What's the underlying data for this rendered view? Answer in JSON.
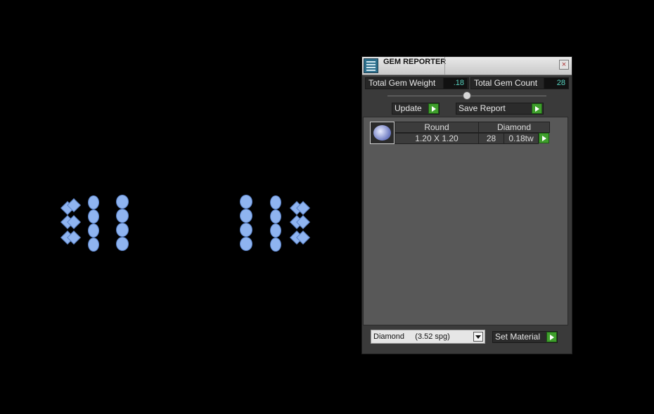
{
  "panel": {
    "title": "GEM REPORTER",
    "close": "×",
    "total_weight_label": "Total Gem Weight",
    "total_weight_value": ".18",
    "total_count_label": "Total Gem Count",
    "total_count_value": "28",
    "update_label": "Update",
    "save_report_label": "Save Report",
    "material_select_value": "Diamond     (3.52 spg)",
    "set_material_label": "Set Material",
    "rows": [
      {
        "shape": "Round",
        "material": "Diamond",
        "size": "1.20 X 1.20",
        "count": "28",
        "weight": "0.18tw"
      }
    ]
  },
  "colors": {
    "gem_fill": "#8fb4f0",
    "accent_green": "#3f9f2c",
    "value_text": "#58d6c2"
  }
}
